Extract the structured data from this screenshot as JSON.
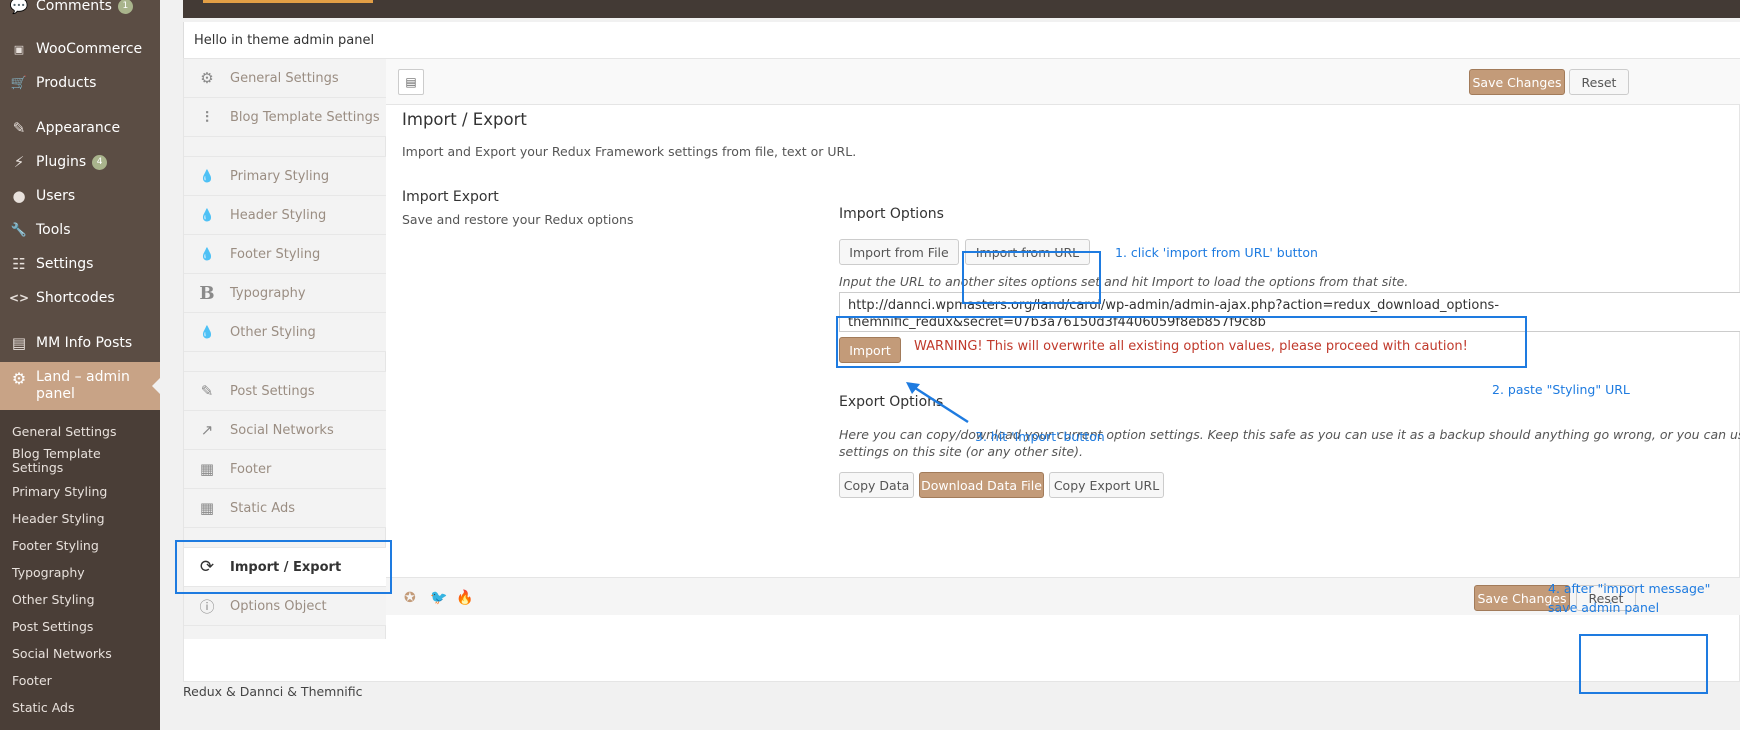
{
  "wp_menu": {
    "items": [
      {
        "label": "Comments",
        "icon": "comments-icon",
        "glyph": "💬",
        "badge": "1"
      },
      {
        "label": "WooCommerce",
        "icon": "woocommerce-icon",
        "glyph": "▣",
        "badge": null
      },
      {
        "label": "Products",
        "icon": "cart-icon",
        "glyph": "🛒",
        "badge": null
      },
      {
        "label": "Appearance",
        "icon": "brush-icon",
        "glyph": "✎",
        "badge": null
      },
      {
        "label": "Plugins",
        "icon": "plug-icon",
        "glyph": "⚡",
        "badge": "4"
      },
      {
        "label": "Users",
        "icon": "user-icon",
        "glyph": "●",
        "badge": null
      },
      {
        "label": "Tools",
        "icon": "wrench-icon",
        "glyph": "🔧",
        "badge": null
      },
      {
        "label": "Settings",
        "icon": "settings-icon",
        "glyph": "☷",
        "badge": null
      },
      {
        "label": "Shortcodes",
        "icon": "code-icon",
        "glyph": "<>",
        "badge": null
      },
      {
        "label": "MM Info Posts",
        "icon": "posts-icon",
        "glyph": "▤",
        "badge": null
      }
    ],
    "active": {
      "label": "Land – admin panel",
      "icon": "gear-icon",
      "glyph": "⚙"
    },
    "submenu": [
      "General Settings",
      "Blog Template Settings",
      "Primary Styling",
      "Header Styling",
      "Footer Styling",
      "Typography",
      "Other Styling",
      "Post Settings",
      "Social Networks",
      "Footer",
      "Static Ads"
    ]
  },
  "notice": "Hello in theme admin panel",
  "redux_tabs": [
    {
      "label": "General Settings",
      "icon": "cogs-icon",
      "glyph": "⚙"
    },
    {
      "label": "Blog Template Settings",
      "icon": "sliders-icon",
      "glyph": "⫶"
    },
    {
      "label": "Primary Styling",
      "icon": "drop-icon",
      "glyph": "💧"
    },
    {
      "label": "Header Styling",
      "icon": "drop-icon",
      "glyph": "💧"
    },
    {
      "label": "Footer Styling",
      "icon": "drop-icon",
      "glyph": "💧"
    },
    {
      "label": "Typography",
      "icon": "bold-icon",
      "glyph": "B"
    },
    {
      "label": "Other Styling",
      "icon": "drop-icon",
      "glyph": "💧"
    },
    {
      "label": "Post Settings",
      "icon": "edit-icon",
      "glyph": "✎"
    },
    {
      "label": "Social Networks",
      "icon": "share-icon",
      "glyph": "↗"
    },
    {
      "label": "Footer",
      "icon": "footer-icon",
      "glyph": "▦"
    },
    {
      "label": "Static Ads",
      "icon": "ads-icon",
      "glyph": "▦"
    },
    {
      "label": "Import / Export",
      "icon": "refresh-icon",
      "glyph": "⟳"
    },
    {
      "label": "Options Object",
      "icon": "info-icon",
      "glyph": "ⓘ"
    }
  ],
  "toolbar": {
    "save_label": "Save Changes",
    "reset_label": "Reset"
  },
  "section": {
    "title": "Import / Export",
    "description": "Import and Export your Redux Framework settings from file, text or URL.",
    "field_title": "Import Export",
    "field_subtitle": "Save and restore your Redux options"
  },
  "import": {
    "heading": "Import Options",
    "from_file_label": "Import from File",
    "from_url_label": "Import from URL",
    "url_help": "Input the URL to another sites options set and hit Import to load the options from that site.",
    "url_value": "http://dannci.wpmasters.org/land/carol/wp-admin/admin-ajax.php?action=redux_download_options-themnific_redux&secret=07b3a76150d3f4406059f8eb857f9c8b",
    "url_line1": "http://dannci.wpmasters.org/land/carol/wp-admin/admin-ajax.php?action=redux_download_options-",
    "url_line2": "themnific_redux&secret=07b3a76150d3f4406059f8eb857f9c8b",
    "import_label": "Import",
    "warning": "WARNING! This will overwrite all existing option values, please proceed with caution!"
  },
  "export": {
    "heading": "Export Options",
    "help_line1": "Here you can copy/download your current option settings. Keep this safe as you can use it as a backup should anything go wrong, or you can use i",
    "help_line2": "settings on this site (or any other site).",
    "copy_label": "Copy Data",
    "download_label": "Download Data File",
    "copy_url_label": "Copy Export URL"
  },
  "credits": "Redux & Dannci & Themnific",
  "annotations": {
    "step1": "1. click 'import from URL' button",
    "step2": "2. paste \"Styling\" URL",
    "step3": "3. hit 'Import' button",
    "step4_line1": "4. after \"import message\"",
    "step4_line2": "save admin panel"
  },
  "colors": {
    "accent": "#c39b79",
    "sidebar": "#5b4d44",
    "annotation": "#1e7be0",
    "warning": "#c0392b"
  }
}
